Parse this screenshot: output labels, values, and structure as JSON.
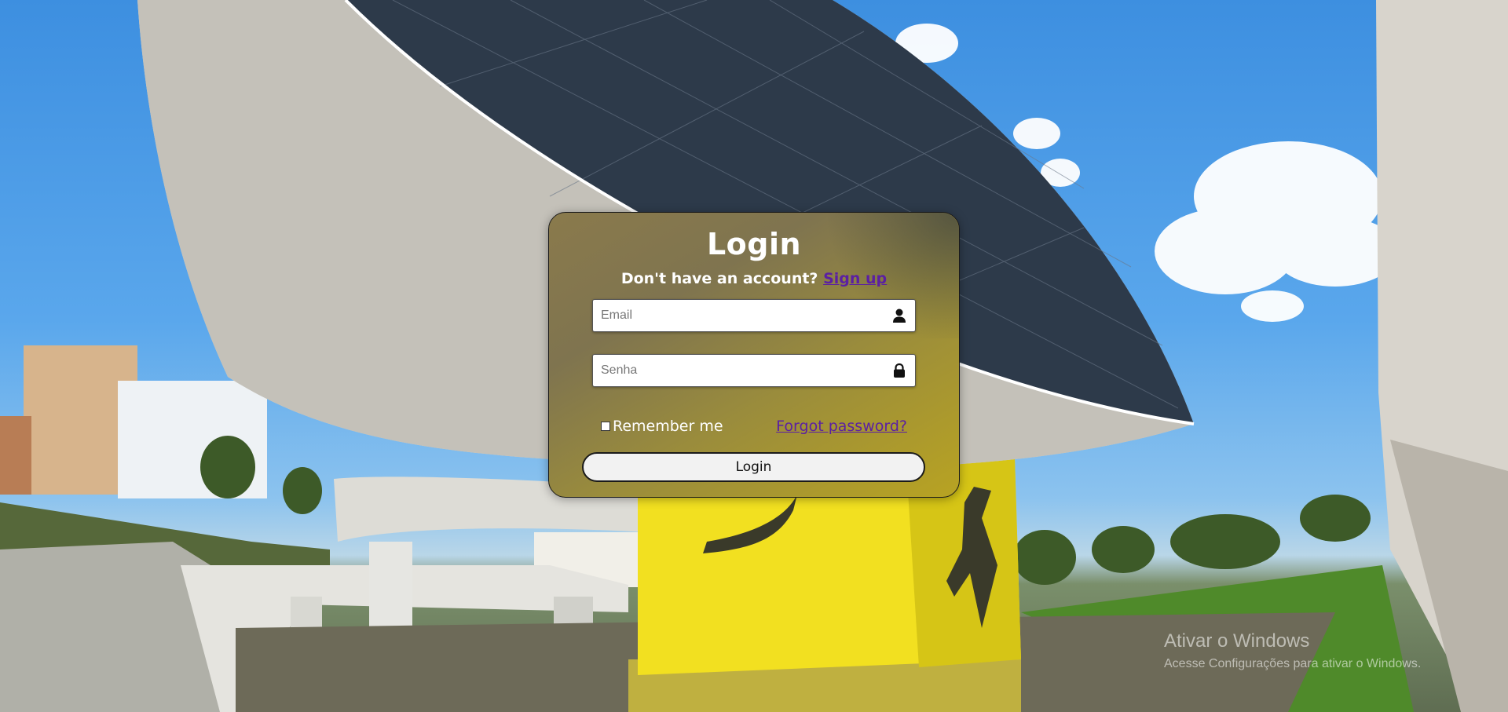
{
  "login": {
    "title": "Login",
    "signup_prompt": "Don't have an account?",
    "signup_link": "Sign up",
    "email_placeholder": "Email",
    "password_placeholder": "Senha",
    "remember_label": "Remember me",
    "forgot_link": "Forgot password?",
    "submit_label": "Login",
    "email_icon": "user-icon",
    "password_icon": "lock-icon"
  },
  "watermark": {
    "title": "Ativar o Windows",
    "subtitle": "Acesse Configurações para ativar o Windows."
  },
  "colors": {
    "card_gradient_start": "#8a7a4c",
    "card_gradient_end": "#b8a322",
    "link": "#5b1fa3",
    "sky": "#3d8fe0",
    "pillar_yellow": "#f2e020"
  }
}
